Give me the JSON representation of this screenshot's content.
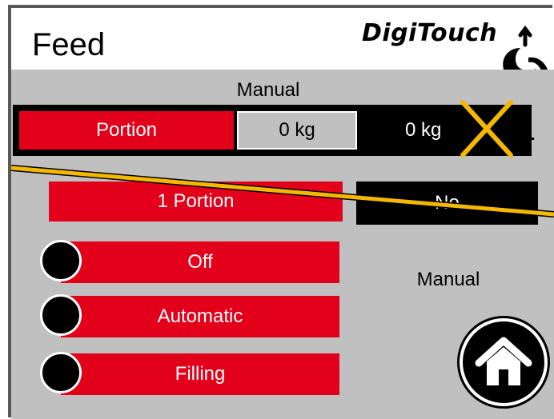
{
  "header": {
    "title": "Feed",
    "logo_text": "DigiTouch"
  },
  "mode_label": "Manual",
  "portion_bar": {
    "name": "Portion",
    "value1": "0 kg",
    "value2": "0 kg",
    "count": "1"
  },
  "portion_button": "1 Portion",
  "no_button": "No",
  "options": [
    "Off",
    "Automatic",
    "Filling"
  ],
  "status_label": "Manual",
  "colors": {
    "accent": "#e2001a",
    "panel": "#c0c0c0",
    "overlay_line": "#f5b800"
  }
}
